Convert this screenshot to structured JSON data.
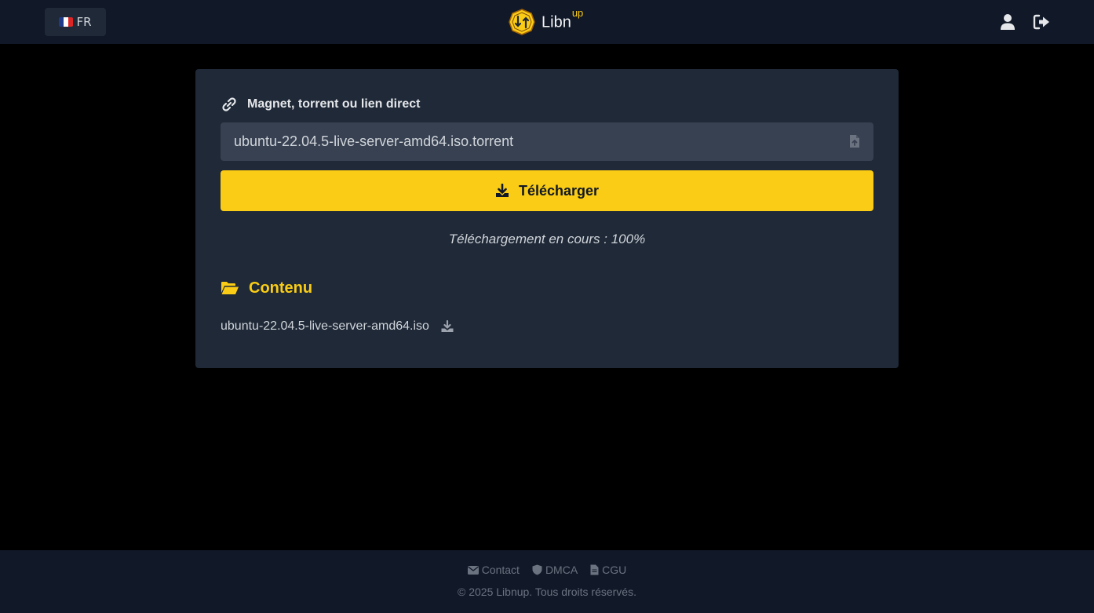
{
  "header": {
    "language_label": "FR",
    "logo_text": "Libn",
    "logo_sup": "up"
  },
  "form": {
    "label": "Magnet, torrent ou lien direct",
    "input_value": "ubuntu-22.04.5-live-server-amd64.iso.torrent",
    "download_button": "Télécharger"
  },
  "status_text": "Téléchargement en cours : 100%",
  "content": {
    "title": "Contenu",
    "files": [
      {
        "name": "ubuntu-22.04.5-live-server-amd64.iso"
      }
    ]
  },
  "footer": {
    "links": [
      {
        "label": "Contact",
        "icon": "envelope-icon"
      },
      {
        "label": "DMCA",
        "icon": "shield-icon"
      },
      {
        "label": "CGU",
        "icon": "document-icon"
      }
    ],
    "copyright": "© 2025 Libnup. Tous droits réservés."
  },
  "colors": {
    "background": "#000000",
    "header_bg": "#111827",
    "card_bg": "#1f2937",
    "input_bg": "#374151",
    "accent": "#facc15"
  },
  "icons": {
    "flag": "france-flag-icon",
    "user": "user-icon",
    "logout": "logout-icon",
    "link": "link-icon",
    "upload": "file-upload-icon",
    "download": "download-icon",
    "folder": "folder-open-icon"
  }
}
